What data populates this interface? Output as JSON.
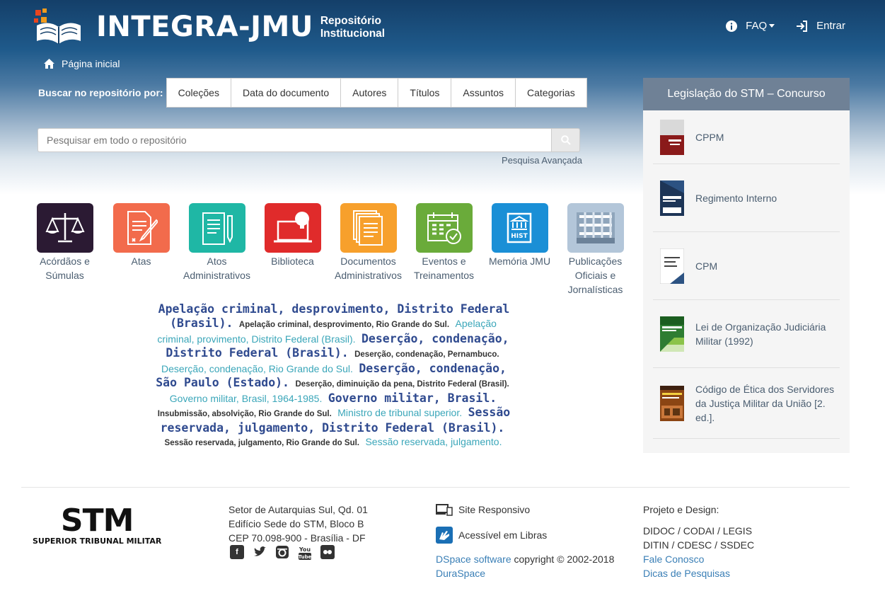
{
  "header": {
    "title": "INTEGRA-JMU",
    "subtitle_line1": "Repositório",
    "subtitle_line2": "Institucional",
    "faq": "FAQ",
    "login": "Entrar"
  },
  "breadcrumb": {
    "home": "Página inicial"
  },
  "browse": {
    "label": "Buscar no repositório por:",
    "buttons": [
      "Coleções",
      "Data do documento",
      "Autores",
      "Títulos",
      "Assuntos",
      "Categorias"
    ]
  },
  "search": {
    "placeholder": "Pesquisar em todo o repositório",
    "advanced": "Pesquisa Avançada"
  },
  "communities": [
    {
      "line1": "Acórdãos e",
      "line2": "Súmulas",
      "line3": "",
      "color": "#2b1a33",
      "icon": "scales-icon"
    },
    {
      "line1": "Atas",
      "line2": "",
      "line3": "",
      "color": "#f26b4c",
      "icon": "document-pen-icon"
    },
    {
      "line1": "Atos",
      "line2": "Administrativos",
      "line3": "",
      "color": "#1fb7a5",
      "icon": "clipboard-pen-icon"
    },
    {
      "line1": "Biblioteca",
      "line2": "",
      "line3": "",
      "color": "#e02b2b",
      "icon": "laptop-bulb-icon"
    },
    {
      "line1": "Documentos",
      "line2": "Administrativos",
      "line3": "",
      "color": "#f7a02c",
      "icon": "documents-stack-icon"
    },
    {
      "line1": "Eventos e",
      "line2": "Treinamentos",
      "line3": "",
      "color": "#6aab3a",
      "icon": "calendar-check-icon"
    },
    {
      "line1": "Memória JMU",
      "line2": "",
      "line3": "",
      "color": "#1a8fd6",
      "icon": "hist-book-icon"
    },
    {
      "line1": "Publicações",
      "line2": "Oficiais e",
      "line3": "Jornalísticas",
      "color": "#b3c6d9",
      "icon": "newspapers-icon"
    }
  ],
  "tag_cloud": [
    {
      "text": "Apelação criminal, desprovimento, Distrito Federal (Brasil).",
      "style": "big"
    },
    {
      "text": "Apelação criminal, desprovimento, Rio Grande do Sul.",
      "style": "sm"
    },
    {
      "text": "Apelação criminal, provimento, Distrito Federal (Brasil).",
      "style": "link"
    },
    {
      "text": "Deserção, condenação, Distrito Federal (Brasil).",
      "style": "big"
    },
    {
      "text": "Deserção, condenação, Pernambuco.",
      "style": "sm"
    },
    {
      "text": "Deserção, condenação, Rio Grande do Sul.",
      "style": "link"
    },
    {
      "text": "Deserção, condenação, São Paulo (Estado).",
      "style": "big"
    },
    {
      "text": "Deserção, diminuição da pena, Distrito Federal (Brasil).",
      "style": "sm"
    },
    {
      "text": "Governo militar, Brasil, 1964-1985.",
      "style": "link"
    },
    {
      "text": "Governo militar, Brasil.",
      "style": "big"
    },
    {
      "text": "Insubmissão, absolvição, Rio Grande do Sul.",
      "style": "sm"
    },
    {
      "text": "Ministro de tribunal superior.",
      "style": "link"
    },
    {
      "text": "Sessão reservada, julgamento, Distrito Federal (Brasil).",
      "style": "big"
    },
    {
      "text": "Sessão reservada, julgamento, Rio Grande do Sul.",
      "style": "sm"
    },
    {
      "text": "Sessão reservada, julgamento.",
      "style": "link"
    }
  ],
  "sidebar": {
    "title": "Legislação do STM – Concurso",
    "items": [
      {
        "label": "CPPM",
        "cover": "#8a1a1a"
      },
      {
        "label": "Regimento Interno",
        "cover": "#1d3557"
      },
      {
        "label": "CPM",
        "cover": "#e8edf3"
      },
      {
        "label": "Lei de Organização Judiciária Militar (1992)",
        "cover": "#2e7d32"
      },
      {
        "label": "Código de Ética dos Servidores da Justiça Militar da União [2. ed.].",
        "cover": "#8b4513"
      }
    ]
  },
  "footer": {
    "brand": "STM",
    "brand_sub": "SUPERIOR TRIBUNAL MILITAR",
    "address": [
      "Setor de Autarquias Sul, Qd. 01",
      "Edifício Sede do STM, Bloco B",
      "CEP 70.098-900 - Brasília - DF"
    ],
    "social": [
      "facebook-icon",
      "twitter-icon",
      "instagram-icon",
      "youtube-icon",
      "flickr-icon"
    ],
    "responsive": "Site Responsivo",
    "libras": "Acessível em Libras",
    "dspace_link": "DSpace software",
    "copyright": " copyright © 2002-2018",
    "duraspace": "DuraSpace",
    "project_label": "Projeto e Design:",
    "project_line1": "DIDOC / CODAI / LEGIS",
    "project_line2": "DITIN / CDESC / SSDEC",
    "contact": "Fale Conosco",
    "tips": "Dicas de Pesquisas"
  }
}
